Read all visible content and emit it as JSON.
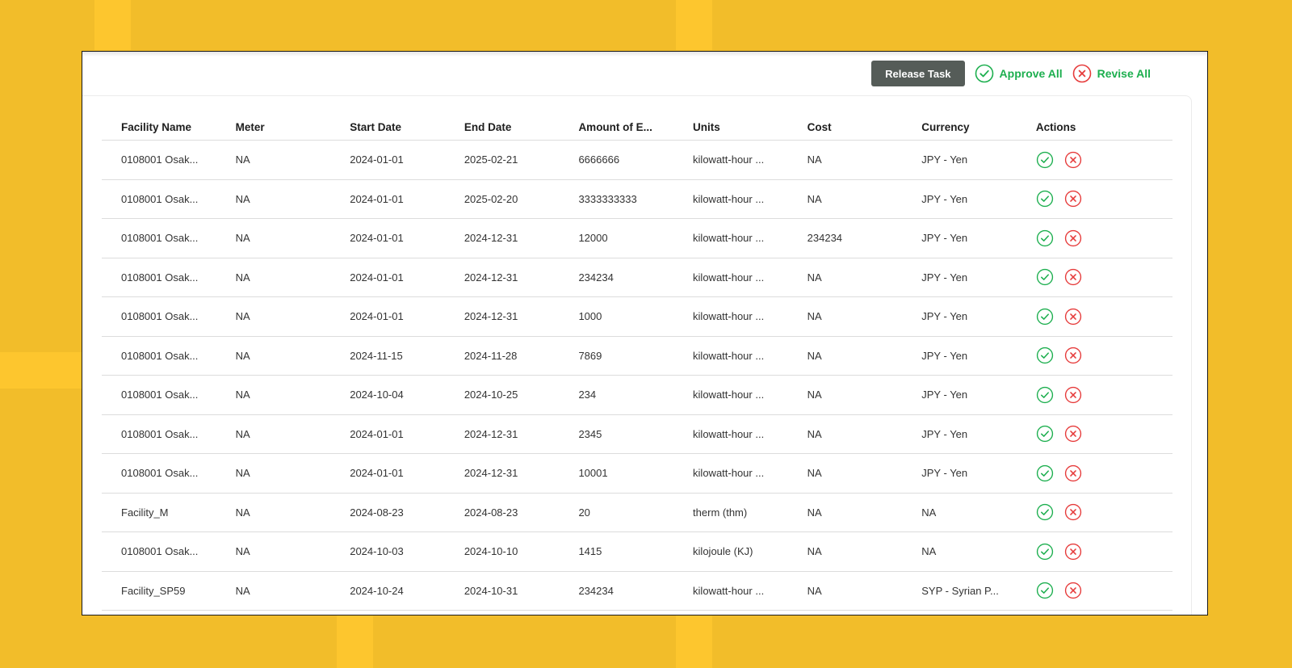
{
  "colors": {
    "accent_green": "#1daf4f",
    "accent_red": "#e63b3b",
    "release_button": "#555c58",
    "background": "#f2bd2a"
  },
  "toolbar": {
    "release_label": "Release Task",
    "approve_all_label": "Approve All",
    "approve_all_icon": "check-circle-icon",
    "revise_all_label": "Revise All",
    "revise_all_icon": "x-circle-icon"
  },
  "table": {
    "headers": [
      "Facility Name",
      "Meter",
      "Start Date",
      "End Date",
      "Amount of E...",
      "Units",
      "Cost",
      "Currency",
      "Actions"
    ],
    "rows": [
      [
        "0108001 Osak...",
        "NA",
        "2024-01-01",
        "2025-02-21",
        "6666666",
        "kilowatt-hour ...",
        "NA",
        "JPY - Yen"
      ],
      [
        "0108001 Osak...",
        "NA",
        "2024-01-01",
        "2025-02-20",
        "3333333333",
        "kilowatt-hour ...",
        "NA",
        "JPY - Yen"
      ],
      [
        "0108001 Osak...",
        "NA",
        "2024-01-01",
        "2024-12-31",
        "12000",
        "kilowatt-hour ...",
        "234234",
        "JPY - Yen"
      ],
      [
        "0108001 Osak...",
        "NA",
        "2024-01-01",
        "2024-12-31",
        "234234",
        "kilowatt-hour ...",
        "NA",
        "JPY - Yen"
      ],
      [
        "0108001 Osak...",
        "NA",
        "2024-01-01",
        "2024-12-31",
        "1000",
        "kilowatt-hour ...",
        "NA",
        "JPY - Yen"
      ],
      [
        "0108001 Osak...",
        "NA",
        "2024-11-15",
        "2024-11-28",
        "7869",
        "kilowatt-hour ...",
        "NA",
        "JPY - Yen"
      ],
      [
        "0108001 Osak...",
        "NA",
        "2024-10-04",
        "2024-10-25",
        "234",
        "kilowatt-hour ...",
        "NA",
        "JPY - Yen"
      ],
      [
        "0108001 Osak...",
        "NA",
        "2024-01-01",
        "2024-12-31",
        "2345",
        "kilowatt-hour ...",
        "NA",
        "JPY - Yen"
      ],
      [
        "0108001 Osak...",
        "NA",
        "2024-01-01",
        "2024-12-31",
        "10001",
        "kilowatt-hour ...",
        "NA",
        "JPY - Yen"
      ],
      [
        "Facility_M",
        "NA",
        "2024-08-23",
        "2024-08-23",
        "20",
        "therm (thm)",
        "NA",
        "NA"
      ],
      [
        "0108001 Osak...",
        "NA",
        "2024-10-03",
        "2024-10-10",
        "1415",
        "kilojoule (KJ)",
        "NA",
        "NA"
      ],
      [
        "Facility_SP59",
        "NA",
        "2024-10-24",
        "2024-10-31",
        "234234",
        "kilowatt-hour ...",
        "NA",
        "SYP - Syrian P..."
      ]
    ],
    "row_actions": [
      {
        "name": "approve",
        "icon": "check-circle-icon"
      },
      {
        "name": "revise",
        "icon": "x-circle-icon"
      }
    ]
  }
}
